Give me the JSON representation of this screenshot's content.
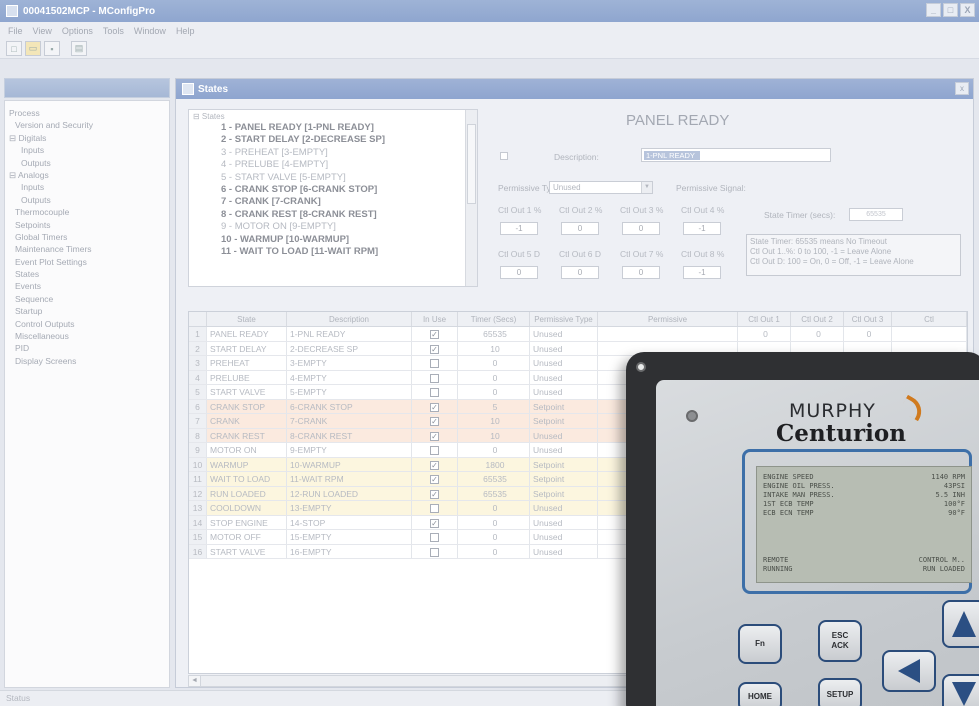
{
  "window": {
    "title": "00041502MCP - MConfigPro",
    "buttons": [
      "_",
      "□",
      "X"
    ]
  },
  "menu": [
    "File",
    "View",
    "Options",
    "Tools",
    "Window",
    "Help"
  ],
  "toolbar": [
    "new-icon",
    "open-icon",
    "save-icon",
    "print-icon"
  ],
  "tree": {
    "items": [
      {
        "label": "Process",
        "indent": 0
      },
      {
        "label": "Version and Security",
        "indent": 1
      },
      {
        "label": "⊟ Digitals",
        "indent": 0
      },
      {
        "label": "Inputs",
        "indent": 2
      },
      {
        "label": "Outputs",
        "indent": 2
      },
      {
        "label": "⊟ Analogs",
        "indent": 0
      },
      {
        "label": "Inputs",
        "indent": 2
      },
      {
        "label": "Outputs",
        "indent": 2
      },
      {
        "label": "Thermocouple",
        "indent": 1
      },
      {
        "label": "Setpoints",
        "indent": 1
      },
      {
        "label": "Global Timers",
        "indent": 1
      },
      {
        "label": "Maintenance Timers",
        "indent": 1
      },
      {
        "label": "Event Plot Settings",
        "indent": 1
      },
      {
        "label": "States",
        "indent": 1
      },
      {
        "label": "Events",
        "indent": 1
      },
      {
        "label": "Sequence",
        "indent": 1
      },
      {
        "label": "Startup",
        "indent": 1
      },
      {
        "label": "Control Outputs",
        "indent": 1
      },
      {
        "label": "Miscellaneous",
        "indent": 1
      },
      {
        "label": "PID",
        "indent": 1
      },
      {
        "label": "Display Screens",
        "indent": 1
      }
    ]
  },
  "states_window": {
    "title": "States",
    "close": "x",
    "root_label": "⊟ States",
    "list": [
      {
        "text": "1 - PANEL READY [1-PNL READY]",
        "bold": true
      },
      {
        "text": "2 - START DELAY [2-DECREASE SP]",
        "bold": true
      },
      {
        "text": "3 - PREHEAT [3-EMPTY]",
        "bold": false
      },
      {
        "text": "4 - PRELUBE [4-EMPTY]",
        "bold": false
      },
      {
        "text": "5 - START VALVE [5-EMPTY]",
        "bold": false
      },
      {
        "text": "6 - CRANK STOP [6-CRANK STOP]",
        "bold": true
      },
      {
        "text": "7 - CRANK [7-CRANK]",
        "bold": true
      },
      {
        "text": "8 - CRANK REST [8-CRANK REST]",
        "bold": true
      },
      {
        "text": "9 - MOTOR ON [9-EMPTY]",
        "bold": false
      },
      {
        "text": "10 - WARMUP [10-WARMUP]",
        "bold": true
      },
      {
        "text": "11 - WAIT TO LOAD [11-WAIT RPM]",
        "bold": true
      }
    ],
    "heading": "PANEL READY",
    "description_label": "Description:",
    "description_value": "1-PNL READY",
    "permissive_type_label": "Permissive Type:",
    "permissive_type_value": "Unused",
    "permissive_signal_label": "Permissive Signal:",
    "cf_labels": [
      "Ctl Out 1 %",
      "Ctl Out 2 %",
      "Ctl Out 3 %",
      "Ctl Out 4 %",
      "Ctl Out 5 D",
      "Ctl Out 6 D",
      "Ctl Out 7 %",
      "Ctl Out 8 %"
    ],
    "cf_values": [
      "-1",
      "0",
      "0",
      "-1",
      "0",
      "0",
      "0",
      "-1"
    ],
    "state_timer_label": "State Timer (secs):",
    "state_timer_value": "65535",
    "info_lines": [
      "State Timer: 65535 means No Timeout",
      "Ctl Out 1..%: 0 to 100, -1 = Leave Alone",
      "Ctl Out D: 100 = On, 0 = Off, -1 = Leave Alone"
    ]
  },
  "grid": {
    "headers": [
      "",
      "State",
      "Description",
      "In Use",
      "Timer (Secs)",
      "Permissive Type",
      "Permissive",
      "Ctl Out 1",
      "Ctl Out 2",
      "Ctl Out 3",
      "Ctl"
    ],
    "rows": [
      {
        "num": "1",
        "state": "PANEL READY",
        "desc": "1-PNL READY",
        "use": true,
        "timer": "65535",
        "ptype": "Unused",
        "cf1": "0",
        "cf2": "0",
        "cf3": "0",
        "tone": ""
      },
      {
        "num": "2",
        "state": "START DELAY",
        "desc": "2-DECREASE SP",
        "use": true,
        "timer": "10",
        "ptype": "Unused",
        "cf1": "",
        "cf2": "",
        "cf3": "",
        "tone": ""
      },
      {
        "num": "3",
        "state": "PREHEAT",
        "desc": "3-EMPTY",
        "use": false,
        "timer": "0",
        "ptype": "Unused",
        "cf1": "",
        "cf2": "",
        "cf3": "",
        "tone": ""
      },
      {
        "num": "4",
        "state": "PRELUBE",
        "desc": "4-EMPTY",
        "use": false,
        "timer": "0",
        "ptype": "Unused",
        "cf1": "",
        "cf2": "",
        "cf3": "",
        "tone": ""
      },
      {
        "num": "5",
        "state": "START VALVE",
        "desc": "5-EMPTY",
        "use": false,
        "timer": "0",
        "ptype": "Unused",
        "cf1": "",
        "cf2": "",
        "cf3": "",
        "tone": ""
      },
      {
        "num": "6",
        "state": "CRANK STOP",
        "desc": "6-CRANK STOP",
        "use": true,
        "timer": "5",
        "ptype": "Setpoint",
        "cf1": "",
        "cf2": "",
        "cf3": "",
        "tone": "orange"
      },
      {
        "num": "7",
        "state": "CRANK",
        "desc": "7-CRANK",
        "use": true,
        "timer": "10",
        "ptype": "Setpoint",
        "cf1": "",
        "cf2": "",
        "cf3": "",
        "tone": "orange"
      },
      {
        "num": "8",
        "state": "CRANK REST",
        "desc": "8-CRANK REST",
        "use": true,
        "timer": "10",
        "ptype": "Unused",
        "cf1": "",
        "cf2": "",
        "cf3": "",
        "tone": "orange"
      },
      {
        "num": "9",
        "state": "MOTOR ON",
        "desc": "9-EMPTY",
        "use": false,
        "timer": "0",
        "ptype": "Unused",
        "cf1": "",
        "cf2": "",
        "cf3": "",
        "tone": ""
      },
      {
        "num": "10",
        "state": "WARMUP",
        "desc": "10-WARMUP",
        "use": true,
        "timer": "1800",
        "ptype": "Setpoint",
        "cf1": "",
        "cf2": "",
        "cf3": "",
        "tone": "yellow"
      },
      {
        "num": "11",
        "state": "WAIT TO LOAD",
        "desc": "11-WAIT RPM",
        "use": true,
        "timer": "65535",
        "ptype": "Setpoint",
        "cf1": "",
        "cf2": "",
        "cf3": "",
        "tone": "yellow"
      },
      {
        "num": "12",
        "state": "RUN LOADED",
        "desc": "12-RUN LOADED",
        "use": true,
        "timer": "65535",
        "ptype": "Setpoint",
        "cf1": "",
        "cf2": "",
        "cf3": "",
        "tone": "yellow"
      },
      {
        "num": "13",
        "state": "COOLDOWN",
        "desc": "13-EMPTY",
        "use": false,
        "timer": "0",
        "ptype": "Unused",
        "cf1": "",
        "cf2": "",
        "cf3": "",
        "tone": "yellow"
      },
      {
        "num": "14",
        "state": "STOP ENGINE",
        "desc": "14-STOP",
        "use": true,
        "timer": "0",
        "ptype": "Unused",
        "cf1": "",
        "cf2": "",
        "cf3": "",
        "tone": ""
      },
      {
        "num": "15",
        "state": "MOTOR OFF",
        "desc": "15-EMPTY",
        "use": false,
        "timer": "0",
        "ptype": "Unused",
        "cf1": "",
        "cf2": "",
        "cf3": "",
        "tone": ""
      },
      {
        "num": "16",
        "state": "START VALVE",
        "desc": "16-EMPTY",
        "use": false,
        "timer": "0",
        "ptype": "Unused",
        "cf1": "",
        "cf2": "",
        "cf3": "",
        "tone": ""
      }
    ]
  },
  "status_bar": "Status",
  "device": {
    "brand": "MURPHY",
    "model": "Centurion",
    "lcd_rows": [
      [
        "ENGINE SPEED",
        "1140 RPM"
      ],
      [
        "ENGINE OIL PRESS.",
        "43PSI"
      ],
      [
        "INTAKE MAN PRESS.",
        "5.5 INH"
      ],
      [
        "1ST ECB TEMP",
        "100°F"
      ],
      [
        "ECB ECN TEMP",
        "90°F"
      ]
    ],
    "lcd_footer": [
      [
        "REMOTE",
        "CONTROL M.."
      ],
      [
        "RUNNING",
        "RUN LOADED"
      ]
    ],
    "keys": {
      "fn": "Fn",
      "esc": "ESC",
      "ack": "ACK",
      "home": "HOME",
      "setup": "SETUP"
    },
    "colors": {
      "accent": "#3d6fa8",
      "swoosh": "#d07a1e"
    }
  }
}
